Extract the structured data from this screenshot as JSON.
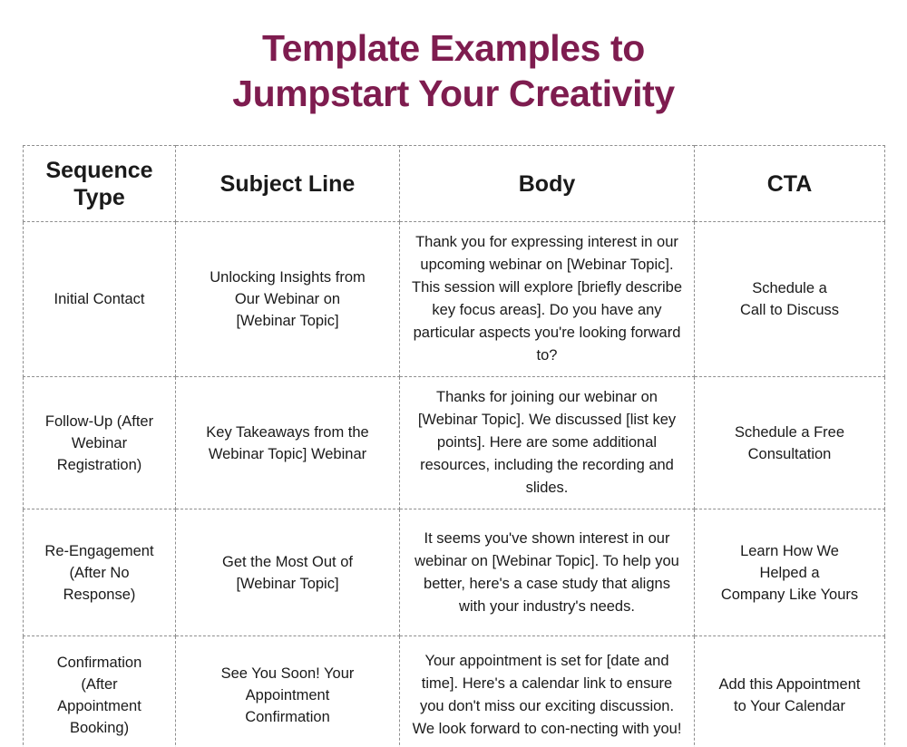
{
  "title": {
    "line1": "Template Examples to",
    "line2": "Jumpstart Your Creativity",
    "color": "#7e1c4f"
  },
  "table": {
    "headers": {
      "sequence_type": "Sequence\nType",
      "subject_line": "Subject Line",
      "body": "Body",
      "cta": "CTA"
    },
    "rows": [
      {
        "sequence_type": "Initial Contact",
        "subject_line": "Unlocking Insights from\nOur Webinar on\n[Webinar Topic]",
        "body": "Thank you for expressing interest in our upcoming webinar on [Webinar Topic]. This session will explore [briefly describe key focus areas]. Do you have any particular aspects you're looking forward to?",
        "cta": "Schedule a\nCall to Discuss"
      },
      {
        "sequence_type": "Follow-Up (After\nWebinar\nRegistration)",
        "subject_line": "Key Takeaways from the\nWebinar Topic] Webinar",
        "body": "Thanks for joining our webinar on [Webinar Topic]. We discussed [list key points]. Here are some additional resources, including the recording and slides.",
        "cta": "Schedule a Free\nConsultation"
      },
      {
        "sequence_type": "Re-Engagement\n(After No\nResponse)",
        "subject_line": "Get the Most Out of\n[Webinar Topic]",
        "body": "It seems you've shown interest in our webinar on [Webinar Topic]. To help you better, here's a case study that aligns with your industry's needs.",
        "cta": "Learn How We\nHelped a\nCompany Like Yours"
      },
      {
        "sequence_type": "Confirmation\n(After\nAppointment\nBooking)",
        "subject_line": "See You Soon! Your\nAppointment\nConfirmation",
        "body": "Your appointment is set for [date and time]. Here's a calendar link to ensure you don't miss our exciting discussion. We look forward to con-necting with you!",
        "cta": "Add this Appointment\nto Your Calendar"
      }
    ]
  },
  "styles": {
    "border_color": "#8e8e8e",
    "text_color": "#1c1c1c",
    "background": "#ffffff"
  }
}
